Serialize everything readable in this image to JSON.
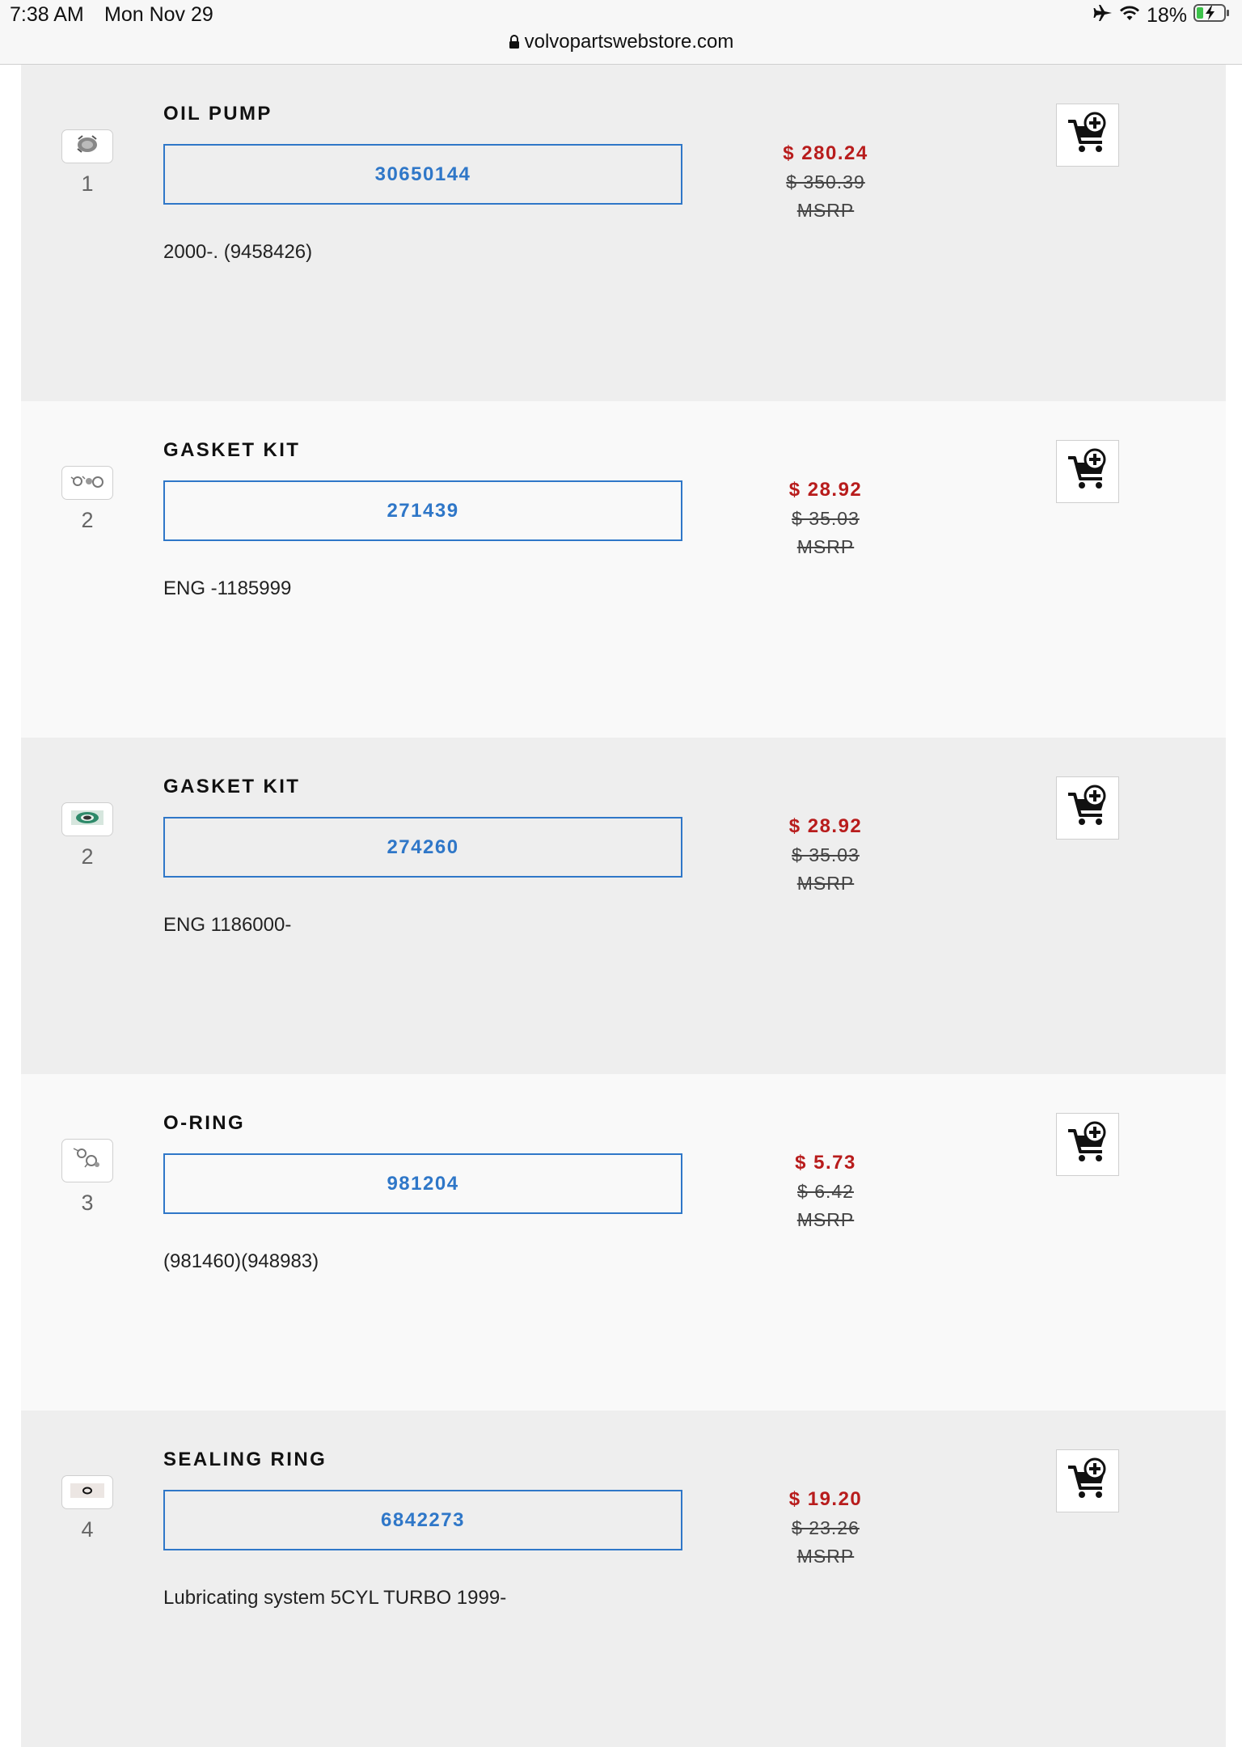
{
  "status": {
    "time": "7:38 AM",
    "date": "Mon Nov 29",
    "battery": "18%"
  },
  "browser": {
    "url": "volvopartswebstore.com"
  },
  "parts": [
    {
      "ref": "1",
      "thumb_icon": "oil-pump-thumbnail",
      "title": "OIL PUMP",
      "part_number": "30650144",
      "description": "2000-. (9458426)",
      "price": "$ 280.24",
      "msrp_price": "$ 350.39",
      "msrp_label": "MSRP"
    },
    {
      "ref": "2",
      "thumb_icon": "gasket-kit-thumbnail",
      "title": "GASKET KIT",
      "part_number": "271439",
      "description": "ENG -1185999",
      "price": "$ 28.92",
      "msrp_price": "$ 35.03",
      "msrp_label": "MSRP"
    },
    {
      "ref": "2",
      "thumb_icon": "gasket-ring-thumbnail",
      "title": "GASKET KIT",
      "part_number": "274260",
      "description": "ENG 1186000-",
      "price": "$ 28.92",
      "msrp_price": "$ 35.03",
      "msrp_label": "MSRP"
    },
    {
      "ref": "3",
      "thumb_icon": "o-ring-thumbnail",
      "title": "O-RING",
      "part_number": "981204",
      "description": "(981460)(948983)",
      "price": "$ 5.73",
      "msrp_price": "$ 6.42",
      "msrp_label": "MSRP"
    },
    {
      "ref": "4",
      "thumb_icon": "sealing-ring-thumbnail",
      "title": "SEALING RING",
      "part_number": "6842273",
      "description": "Lubricating system 5CYL TURBO 1999-",
      "price": "$ 19.20",
      "msrp_price": "$ 23.26",
      "msrp_label": "MSRP"
    }
  ],
  "colors": {
    "sale_price": "#b81c1c",
    "part_link": "#2f77c8",
    "row_shade": "#eeeeee",
    "row_light": "#f9f9f9"
  }
}
